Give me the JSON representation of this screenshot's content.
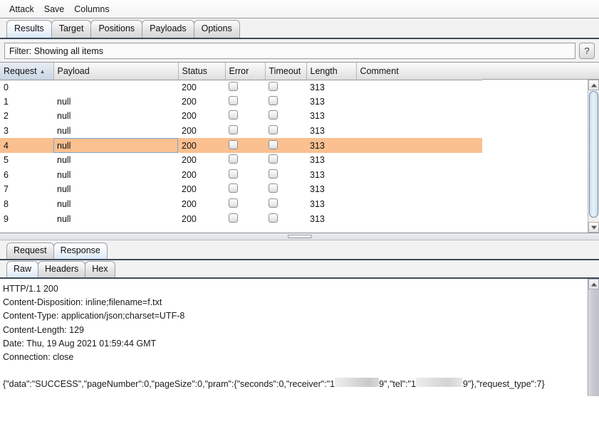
{
  "menu": {
    "items": [
      {
        "label": "Attack"
      },
      {
        "label": "Save"
      },
      {
        "label": "Columns"
      }
    ]
  },
  "main_tabs": [
    {
      "label": "Results",
      "selected": true
    },
    {
      "label": "Target",
      "selected": false
    },
    {
      "label": "Positions",
      "selected": false
    },
    {
      "label": "Payloads",
      "selected": false
    },
    {
      "label": "Options",
      "selected": false
    }
  ],
  "filter": {
    "label": "Filter:",
    "value": "Filter: Showing all items",
    "text": "Showing all items",
    "help_label": "?"
  },
  "table": {
    "columns": [
      {
        "label": "Request",
        "sorted": true,
        "sort_dir": "▲"
      },
      {
        "label": "Payload",
        "sorted": false
      },
      {
        "label": "Status",
        "sorted": false
      },
      {
        "label": "Error",
        "sorted": false
      },
      {
        "label": "Timeout",
        "sorted": false
      },
      {
        "label": "Length",
        "sorted": false
      },
      {
        "label": "Comment",
        "sorted": false
      }
    ],
    "rows": [
      {
        "request": "0",
        "payload": "",
        "status": "200",
        "error": false,
        "timeout": false,
        "length": "313",
        "comment": "",
        "selected": false
      },
      {
        "request": "1",
        "payload": "null",
        "status": "200",
        "error": false,
        "timeout": false,
        "length": "313",
        "comment": "",
        "selected": false
      },
      {
        "request": "2",
        "payload": "null",
        "status": "200",
        "error": false,
        "timeout": false,
        "length": "313",
        "comment": "",
        "selected": false
      },
      {
        "request": "3",
        "payload": "null",
        "status": "200",
        "error": false,
        "timeout": false,
        "length": "313",
        "comment": "",
        "selected": false
      },
      {
        "request": "4",
        "payload": "null",
        "status": "200",
        "error": false,
        "timeout": false,
        "length": "313",
        "comment": "",
        "selected": true
      },
      {
        "request": "5",
        "payload": "null",
        "status": "200",
        "error": false,
        "timeout": false,
        "length": "313",
        "comment": "",
        "selected": false
      },
      {
        "request": "6",
        "payload": "null",
        "status": "200",
        "error": false,
        "timeout": false,
        "length": "313",
        "comment": "",
        "selected": false
      },
      {
        "request": "7",
        "payload": "null",
        "status": "200",
        "error": false,
        "timeout": false,
        "length": "313",
        "comment": "",
        "selected": false
      },
      {
        "request": "8",
        "payload": "null",
        "status": "200",
        "error": false,
        "timeout": false,
        "length": "313",
        "comment": "",
        "selected": false
      },
      {
        "request": "9",
        "payload": "null",
        "status": "200",
        "error": false,
        "timeout": false,
        "length": "313",
        "comment": "",
        "selected": false
      }
    ]
  },
  "message_tabs": [
    {
      "label": "Request",
      "selected": false
    },
    {
      "label": "Response",
      "selected": true
    }
  ],
  "view_tabs": [
    {
      "label": "Raw",
      "selected": true
    },
    {
      "label": "Headers",
      "selected": false
    },
    {
      "label": "Hex",
      "selected": false
    }
  ],
  "response": {
    "headers": [
      "HTTP/1.1 200",
      "Content-Disposition: inline;filename=f.txt",
      "Content-Type: application/json;charset=UTF-8",
      "Content-Length: 129",
      "Date: Thu, 19 Aug 2021 01:59:44 GMT",
      "Connection: close"
    ],
    "headers_text": "HTTP/1.1 200\nContent-Disposition: inline;filename=f.txt\nContent-Type: application/json;charset=UTF-8\nContent-Length: 129\nDate: Thu, 19 Aug 2021 01:59:44 GMT\nConnection: close",
    "body_part1": "{\"data\":\"SUCCESS\",\"pageNumber\":0,\"pageSize\":0,\"pram\":{\"seconds\":0,\"receiver\":\"1",
    "body_part2": "9\",\"tel\":\"1",
    "body_part3": "9\"},\"request_type\":7}"
  },
  "colors": {
    "selected_row": "#fac090",
    "tab_selected": "#d8e7f6",
    "tab_underline": "#3c4a5a",
    "scrollbar_thumb": "#cfe0ee"
  }
}
